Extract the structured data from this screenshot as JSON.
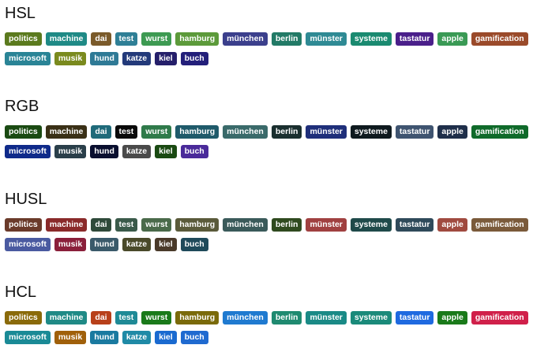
{
  "sections": [
    {
      "title": "HSL",
      "tags": [
        {
          "label": "politics",
          "color": "#5b7a1e"
        },
        {
          "label": "machine",
          "color": "#1f8a86"
        },
        {
          "label": "dai",
          "color": "#7a5a2a"
        },
        {
          "label": "test",
          "color": "#2f7f96"
        },
        {
          "label": "wurst",
          "color": "#3d9a52"
        },
        {
          "label": "hamburg",
          "color": "#5c9a3a"
        },
        {
          "label": "münchen",
          "color": "#3b3f8c"
        },
        {
          "label": "berlin",
          "color": "#227a66"
        },
        {
          "label": "münster",
          "color": "#2f8a94"
        },
        {
          "label": "systeme",
          "color": "#1a8a70"
        },
        {
          "label": "tastatur",
          "color": "#4a1f8a"
        },
        {
          "label": "apple",
          "color": "#3a9a55"
        },
        {
          "label": "gamification",
          "color": "#9a4a2a"
        },
        {
          "label": "microsoft",
          "color": "#2a8496"
        },
        {
          "label": "musik",
          "color": "#7a8a1e"
        },
        {
          "label": "hund",
          "color": "#2f7a96"
        },
        {
          "label": "katze",
          "color": "#233a7a"
        },
        {
          "label": "kiel",
          "color": "#251f6a"
        },
        {
          "label": "buch",
          "color": "#231f7a"
        }
      ]
    },
    {
      "title": "RGB",
      "tags": [
        {
          "label": "politics",
          "color": "#1a4a12"
        },
        {
          "label": "machine",
          "color": "#3a3016"
        },
        {
          "label": "dai",
          "color": "#1f6a7a"
        },
        {
          "label": "test",
          "color": "#0a0a0a"
        },
        {
          "label": "wurst",
          "color": "#2f7a4a"
        },
        {
          "label": "hamburg",
          "color": "#1f5a6a"
        },
        {
          "label": "münchen",
          "color": "#3a6a6a"
        },
        {
          "label": "berlin",
          "color": "#1a2f2f"
        },
        {
          "label": "münster",
          "color": "#1f2f7a"
        },
        {
          "label": "systeme",
          "color": "#0f1a1f"
        },
        {
          "label": "tastatur",
          "color": "#3f5470"
        },
        {
          "label": "apple",
          "color": "#1f2f4a"
        },
        {
          "label": "gamification",
          "color": "#0f6a2a"
        },
        {
          "label": "microsoft",
          "color": "#0f2a8a"
        },
        {
          "label": "musik",
          "color": "#2a3f4a"
        },
        {
          "label": "hund",
          "color": "#0a0f2f"
        },
        {
          "label": "katze",
          "color": "#4a4a4a"
        },
        {
          "label": "kiel",
          "color": "#1a4a12"
        },
        {
          "label": "buch",
          "color": "#4a2a9a"
        }
      ]
    },
    {
      "title": "HUSL",
      "tags": [
        {
          "label": "politics",
          "color": "#6a3a2a"
        },
        {
          "label": "machine",
          "color": "#8a2a2a"
        },
        {
          "label": "dai",
          "color": "#2f4a3a"
        },
        {
          "label": "test",
          "color": "#3a5a4a"
        },
        {
          "label": "wurst",
          "color": "#4a6a4a"
        },
        {
          "label": "hamburg",
          "color": "#5a5a3a"
        },
        {
          "label": "münchen",
          "color": "#3a5a5a"
        },
        {
          "label": "berlin",
          "color": "#2f4a1f"
        },
        {
          "label": "münster",
          "color": "#a04040"
        },
        {
          "label": "systeme",
          "color": "#1f4a4a"
        },
        {
          "label": "tastatur",
          "color": "#2f4a5a"
        },
        {
          "label": "apple",
          "color": "#a04a3f"
        },
        {
          "label": "gamification",
          "color": "#7a5a3a"
        },
        {
          "label": "microsoft",
          "color": "#4a5aa0"
        },
        {
          "label": "musik",
          "color": "#8a1f3a"
        },
        {
          "label": "hund",
          "color": "#3a5a6a"
        },
        {
          "label": "katze",
          "color": "#4a4a2a"
        },
        {
          "label": "kiel",
          "color": "#4a3a2a"
        },
        {
          "label": "buch",
          "color": "#1f4a5a"
        }
      ]
    },
    {
      "title": "HCL",
      "tags": [
        {
          "label": "politics",
          "color": "#8a6a0a"
        },
        {
          "label": "machine",
          "color": "#1f8a86"
        },
        {
          "label": "dai",
          "color": "#b8401a"
        },
        {
          "label": "test",
          "color": "#1f8a96"
        },
        {
          "label": "wurst",
          "color": "#1a7a1a"
        },
        {
          "label": "hamburg",
          "color": "#7a6a0a"
        },
        {
          "label": "münchen",
          "color": "#1f7ad0"
        },
        {
          "label": "berlin",
          "color": "#1f8a70"
        },
        {
          "label": "münster",
          "color": "#1a8a86"
        },
        {
          "label": "systeme",
          "color": "#1a8a7a"
        },
        {
          "label": "tastatur",
          "color": "#1f6ae0"
        },
        {
          "label": "apple",
          "color": "#1a7a1a"
        },
        {
          "label": "gamification",
          "color": "#d0204a"
        },
        {
          "label": "microsoft",
          "color": "#1a8a96"
        },
        {
          "label": "musik",
          "color": "#a0600a"
        },
        {
          "label": "hund",
          "color": "#1a7aa0"
        },
        {
          "label": "katze",
          "color": "#1f8aa6"
        },
        {
          "label": "kiel",
          "color": "#1a6ad0"
        },
        {
          "label": "buch",
          "color": "#1f6ad0"
        }
      ]
    }
  ]
}
